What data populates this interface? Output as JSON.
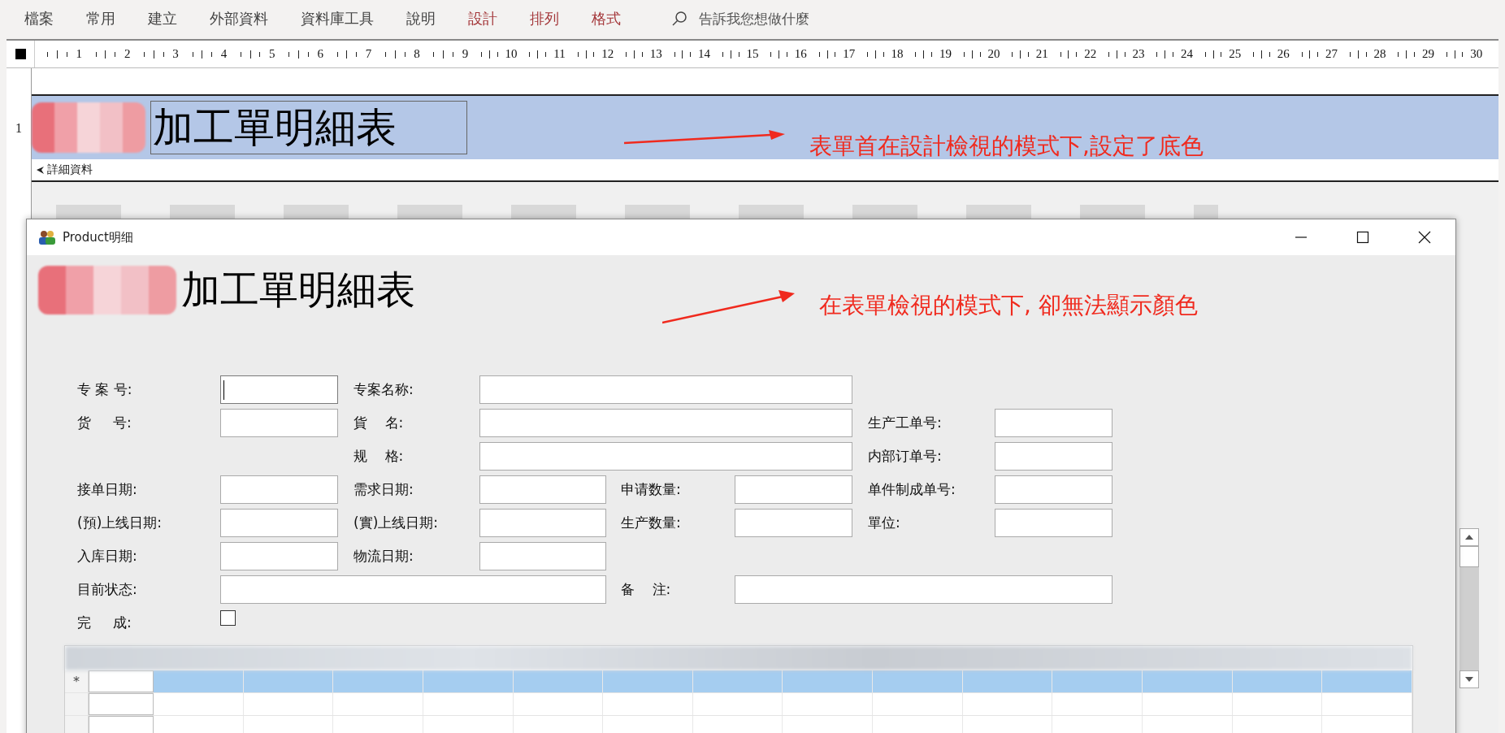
{
  "menu": {
    "items": [
      {
        "label": "檔案",
        "contextual": false
      },
      {
        "label": "常用",
        "contextual": false
      },
      {
        "label": "建立",
        "contextual": false
      },
      {
        "label": "外部資料",
        "contextual": false
      },
      {
        "label": "資料庫工具",
        "contextual": false
      },
      {
        "label": "說明",
        "contextual": false
      },
      {
        "label": "設計",
        "contextual": true
      },
      {
        "label": "排列",
        "contextual": true
      },
      {
        "label": "格式",
        "contextual": true
      }
    ],
    "tell_me": "告訴我您想做什麼"
  },
  "ruler": {
    "labels": [
      "1",
      "2",
      "3",
      "4",
      "5",
      "6",
      "7",
      "8",
      "9",
      "10",
      "11",
      "12",
      "13",
      "14",
      "15",
      "16",
      "17",
      "18",
      "19",
      "20",
      "21",
      "22",
      "23",
      "24",
      "25",
      "26",
      "27",
      "28",
      "29",
      "30"
    ]
  },
  "design_view": {
    "vertical_ruler_label": "1",
    "form_header_title": "加工單明細表",
    "detail_section": "詳細資料",
    "annotation": "表單首在設計檢視的模式下,設定了底色"
  },
  "window": {
    "title": "Product明细",
    "form_title": "加工單明細表",
    "annotation": "在表單檢視的模式下, 卻無法顯示顏色",
    "rows": [
      {
        "cells": [
          {
            "kind": "text",
            "label": "专 案 号:",
            "focused": true
          },
          {
            "kind": "wide",
            "label": "专案名称:",
            "focused": false
          }
        ]
      },
      {
        "cells": [
          {
            "kind": "text",
            "label": "货     号:",
            "focused": false
          },
          {
            "kind": "wide",
            "label": "貨    名:",
            "focused": false
          },
          {
            "kind": "text",
            "label": "生产工单号:",
            "focused": false
          }
        ]
      },
      {
        "cells": [
          {
            "kind": "gap"
          },
          {
            "kind": "wide",
            "label": "规    格:",
            "focused": false
          },
          {
            "kind": "text",
            "label": "内部订单号:",
            "focused": false
          }
        ]
      },
      {
        "cells": [
          {
            "kind": "text",
            "label": "接单日期:",
            "focused": false
          },
          {
            "kind": "text",
            "label": "需求日期:",
            "focused": false
          },
          {
            "kind": "text",
            "label": "申请数量:",
            "focused": false
          },
          {
            "kind": "text",
            "label": "单件制成单号:",
            "focused": false
          }
        ]
      },
      {
        "cells": [
          {
            "kind": "text",
            "label": "(預)上线日期:",
            "focused": false
          },
          {
            "kind": "text",
            "label": "(實)上线日期:",
            "focused": false
          },
          {
            "kind": "text",
            "label": "生产数量:",
            "focused": false
          },
          {
            "kind": "text",
            "label": "單位:",
            "focused": false
          }
        ]
      },
      {
        "cells": [
          {
            "kind": "text",
            "label": "入库日期:",
            "focused": false
          },
          {
            "kind": "text",
            "label": "物流日期:",
            "focused": false
          }
        ]
      },
      {
        "cells": [
          {
            "kind": "wide",
            "label": "目前状态:",
            "focused": false
          },
          {
            "kind": "wide",
            "label": "备    注:",
            "focused": false
          }
        ]
      },
      {
        "cells": [
          {
            "kind": "checkbox",
            "label": "完     成:",
            "checked": false
          }
        ]
      }
    ],
    "datasheet": {
      "new_row_marker": "*"
    }
  }
}
